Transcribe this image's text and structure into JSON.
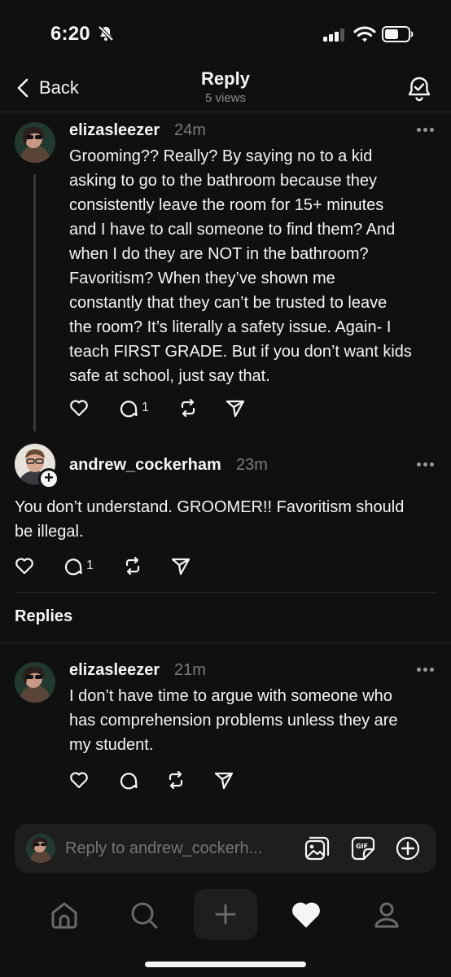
{
  "status_bar": {
    "time": "6:20"
  },
  "header": {
    "back_label": "Back",
    "title": "Reply",
    "subtitle": "5 views"
  },
  "parent_post": {
    "username": "elizasleezer",
    "time": "24m",
    "lines": [
      "Grooming?? Really? By saying no to a kid",
      "asking to go to the bathroom because they",
      "consistently leave the room for 15+ minutes",
      "and I have to call someone to find them? And",
      "when I do they are NOT in the bathroom?",
      "Favoritism? When they’ve shown me",
      "constantly that they can’t be trusted to leave",
      "the room? It’s literally a safety issue. Again- I",
      "teach FIRST GRADE. But if you don’t want kids",
      "safe at school, just say that."
    ],
    "reply_count": "1"
  },
  "focused_post": {
    "username": "andrew_cockerham",
    "time": "23m",
    "lines": [
      "You don’t understand. GROOMER!! Favoritism should",
      "be illegal."
    ],
    "reply_count": "1"
  },
  "replies_section": {
    "label": "Replies"
  },
  "reply_post": {
    "username": "elizasleezer",
    "time": "21m",
    "lines": [
      "I don’t have time to argue with someone who",
      "has comprehension problems unless they are",
      "my student."
    ]
  },
  "composer": {
    "placeholder": "Reply to andrew_cockerh..."
  },
  "colors": {
    "background": "#101010",
    "text": "#f3f5f7",
    "muted": "#7a7a7a",
    "surface": "#1e1e1e"
  }
}
